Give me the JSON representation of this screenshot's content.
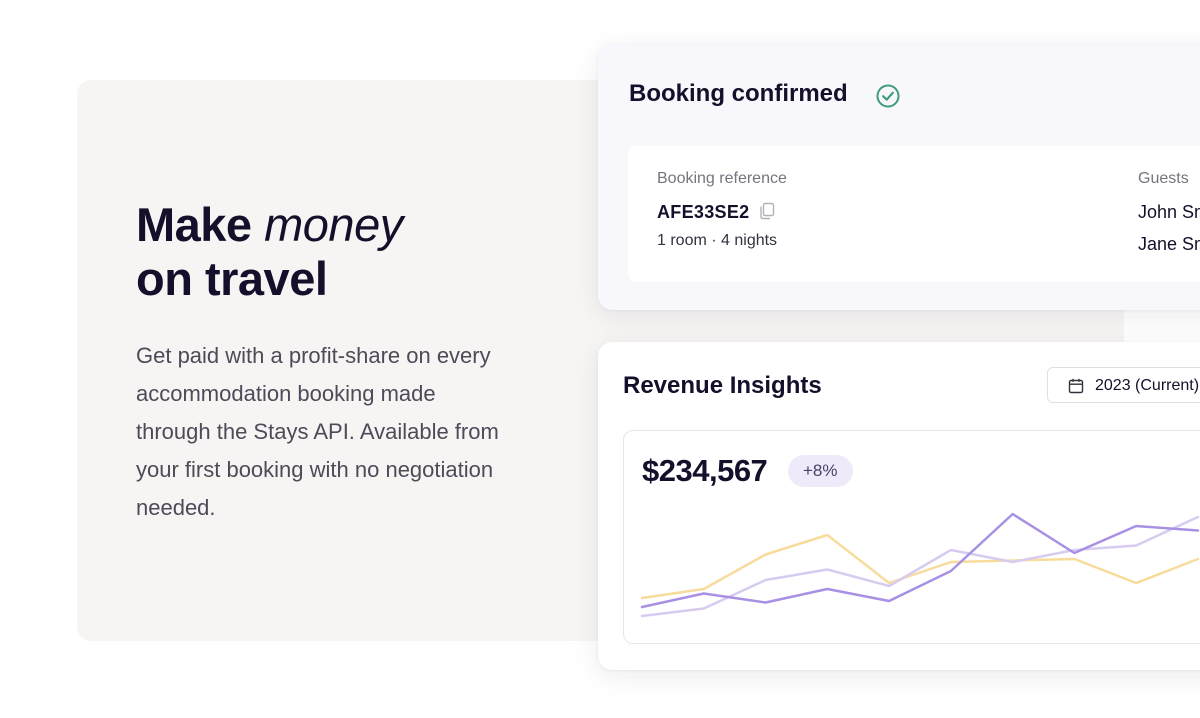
{
  "hero": {
    "headline_line1_plain": "Make ",
    "headline_line1_emphasis": "money",
    "headline_line2": "on travel",
    "body": "Get paid with a profit-share on every accommodation booking made through the Stays API. Available from your first booking with no negotiation needed."
  },
  "booking": {
    "title": "Booking confirmed",
    "status_icon": "check-circle-icon",
    "status_color": "#3e9b7c",
    "reference_label": "Booking reference",
    "reference_value": "AFE33SE2",
    "stay_summary": "1 room · 4 nights",
    "guests_label": "Guests",
    "guests": [
      "John Sm",
      "Jane Sm"
    ]
  },
  "revenue": {
    "title": "Revenue Insights",
    "period_selector": "2023 (Current)",
    "total": "$234,567",
    "change": "+8%"
  },
  "chart_data": {
    "type": "line",
    "x": [
      0,
      1,
      2,
      3,
      4,
      5,
      6,
      7,
      8,
      9
    ],
    "ylim": [
      0,
      100
    ],
    "grid": false,
    "legend": "none",
    "series": [
      {
        "color": "#f7dc9c",
        "values": [
          22,
          28,
          51,
          64,
          32,
          46,
          47,
          48,
          32,
          48
        ]
      },
      {
        "color": "#d7ccf0",
        "values": [
          10,
          15,
          34,
          41,
          30,
          54,
          46,
          54,
          57,
          76
        ]
      },
      {
        "color": "#a990e4",
        "values": [
          16,
          25,
          19,
          28,
          20,
          40,
          78,
          52,
          70,
          67
        ]
      }
    ]
  }
}
